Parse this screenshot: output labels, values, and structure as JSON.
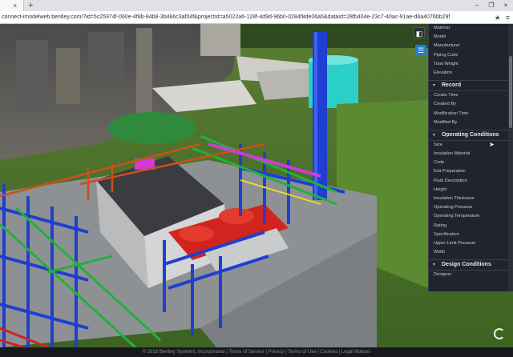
{
  "browser": {
    "new_tab_glyph": "+",
    "tab_close_glyph": "×",
    "url": "connect-imodelweb.bentley.com/?id=5c25974f-060e-4f8b-84b8-3b486c3af04f&projectId=a5022a6-128f-4d9d-96b0-0284f8de06a5&dataId=28fb404e-23c7-40ac-91ae-d6a4076bb29f",
    "window_controls": [
      "–",
      "❐",
      "×"
    ],
    "address_icons": [
      "★",
      "≡"
    ]
  },
  "toolbar": {
    "cube_icon": "◧",
    "list_icon": "☰"
  },
  "panel": {
    "top_items": [
      "Material",
      "Model",
      "Manufacturer",
      "Piping Code",
      "Total Weight",
      "Elevation"
    ],
    "sections": [
      {
        "label": "Record",
        "items": [
          "Create Time",
          "Created By",
          "Modification Time",
          "Modified By"
        ]
      },
      {
        "label": "Operating Conditions",
        "items": [
          "Size",
          "Insulation Material",
          "Code",
          "Exit Preparation",
          "Fluid Description",
          "Height",
          "Insulation Thickness",
          "Operating Pressure",
          "Operating Temperature",
          "Rating",
          "Specification",
          "Upper Limit Pressure",
          "Width"
        ]
      },
      {
        "label": "Design Conditions",
        "items": [
          "Designer"
        ]
      }
    ],
    "chevron_glyph": "▾"
  },
  "footer": {
    "text": "© 2018 Bentley Systems, Incorporated | Terms of Service | Privacy | Terms of Use | Cookies | Legal Notices"
  },
  "colors": {
    "steel_blue": "#1f3fd0",
    "pipe_green": "#22b13a",
    "pipe_red": "#d0241e",
    "pipe_magenta": "#d23ad8",
    "terrain_green": "#4f7a2a",
    "concrete": "#8d9092"
  }
}
